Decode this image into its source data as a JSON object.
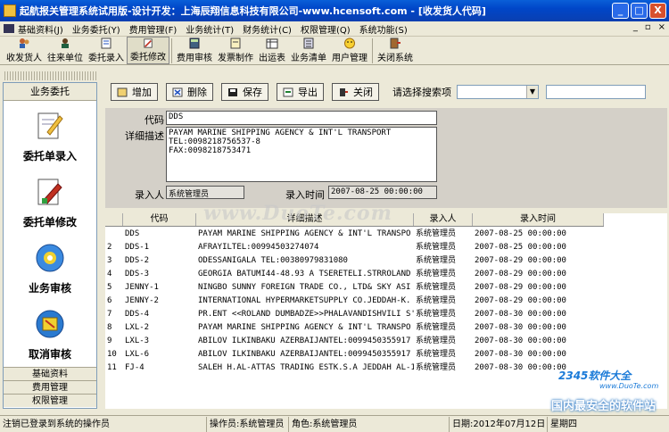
{
  "window": {
    "title": "起航报关管理系统试用版-设计开发：上海辰翔信息科技有限公司-www.hcensoft.com - [收发货人代码]",
    "min": "_",
    "max": "□",
    "close": "X"
  },
  "menu": {
    "items": [
      "基础资料(J)",
      "业务委托(Y)",
      "费用管理(F)",
      "业务统计(T)",
      "财务统计(C)",
      "权限管理(Q)",
      "系统功能(S)"
    ],
    "mdi": [
      "_",
      "▫",
      "×"
    ]
  },
  "toolbar": {
    "items": [
      "收发货人",
      "往来单位",
      "委托录入",
      "委托修改",
      "费用审核",
      "发票制作",
      "出运表",
      "业务清单",
      "用户管理",
      "关闭系统"
    ]
  },
  "leftpanel": {
    "header": "业务委托",
    "items": [
      "委托单录入",
      "委托单修改",
      "业务审核",
      "取消审核"
    ],
    "bottom": [
      "基础资料",
      "费用管理",
      "权限管理"
    ]
  },
  "actions": {
    "add": "增加",
    "delete": "删除",
    "save": "保存",
    "export": "导出",
    "close": "关闭",
    "search_label": "请选择搜索项"
  },
  "form": {
    "code_label": "代码",
    "code_value": "DDS",
    "desc_label": "详细描述",
    "desc_value": "PAYAM MARINE SHIPPING AGENCY & INT'L TRANSPORT\nTEL:0098218756537-8\nFAX:0098218753471",
    "entered_by_label": "录入人",
    "entered_by_value": "系统管理员",
    "entered_time_label": "录入时间",
    "entered_time_value": "2007-08-25 00:00:00"
  },
  "grid": {
    "headers": [
      "代码",
      "详细描述",
      "录入人",
      "录入时间"
    ],
    "rows": [
      [
        "",
        "DDS",
        "PAYAM MARINE SHIPPING AGENCY & INT'L TRANSPO",
        "系统管理员",
        "2007-08-25 00:00:00"
      ],
      [
        "2",
        "DDS-1",
        "AFRAYILTEL:00994503274074",
        "系统管理员",
        "2007-08-25 00:00:00"
      ],
      [
        "3",
        "DDS-2",
        "ODESSANIGALA TEL:00380979831080",
        "系统管理员",
        "2007-08-29 00:00:00"
      ],
      [
        "4",
        "DDS-3",
        "GEORGIA BATUMI44-48.93 A TSERETELI.STRROLAND",
        "系统管理员",
        "2007-08-29 00:00:00"
      ],
      [
        "5",
        "JENNY-1",
        "NINGBO SUNNY FOREIGN TRADE CO., LTD& SKY ASI",
        "系统管理员",
        "2007-08-29 00:00:00"
      ],
      [
        "6",
        "JENNY-2",
        "INTERNATIONAL HYPERMARKETSUPPLY CO.JEDDAH-K.",
        "系统管理员",
        "2007-08-29 00:00:00"
      ],
      [
        "7",
        "DDS-4",
        "PR.ENT <<ROLAND DUMBADZE>>PHALAVANDISHVILI S'",
        "系统管理员",
        "2007-08-30 00:00:00"
      ],
      [
        "8",
        "LXL-2",
        "PAYAM MARINE SHIPPING AGENCY & INT'L TRANSPO",
        "系统管理员",
        "2007-08-30 00:00:00"
      ],
      [
        "9",
        "LXL-3",
        "ABILOV ILKINBAKU AZERBAIJANTEL:0099450355917",
        "系统管理员",
        "2007-08-30 00:00:00"
      ],
      [
        "10",
        "LXL-6",
        "ABILOV ILKINBAKU AZERBAIJANTEL:0099450355917",
        "系统管理员",
        "2007-08-30 00:00:00"
      ],
      [
        "11",
        "FJ-4",
        "SALEH H.AL-ATTAS TRADING ESTK.S.A JEDDAH AL-1",
        "系统管理员",
        "2007-08-30 00:00:00"
      ]
    ]
  },
  "status": {
    "left": "注销已登录到系统的操作员",
    "operator": "操作员:系统管理员",
    "role": "角色:系统管理员",
    "date": "日期:2012年07月12日",
    "weekday": "星期四"
  },
  "watermark": "www.DuoTe.com",
  "logo": {
    "line1": "2345软件大全",
    "line2": "www.DuoTe.com",
    "line3": "国内最安全的软件站"
  }
}
